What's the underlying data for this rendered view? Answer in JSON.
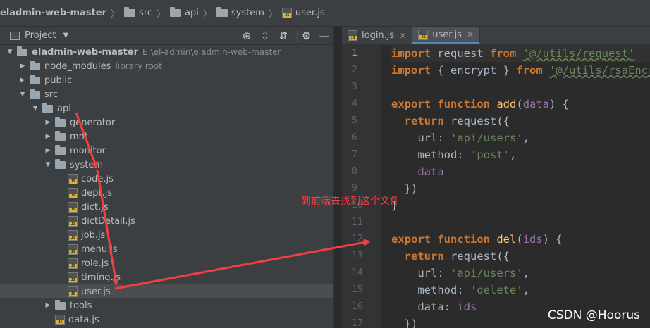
{
  "breadcrumb": [
    "eladmin-web-master",
    "src",
    "api",
    "system",
    "user.js"
  ],
  "project_panel": {
    "title": "Project",
    "tools": [
      "crosshair-icon",
      "expand-all-icon",
      "collapse-all-icon",
      "gear-icon",
      "minimize-icon"
    ]
  },
  "tree": [
    {
      "label": "eladmin-web-master",
      "hint": "E:\\el-admin\\eladmin-web-master",
      "type": "folder",
      "depth": 0,
      "expanded": true
    },
    {
      "label": "node_modules",
      "hint": "library root",
      "type": "folder",
      "depth": 1,
      "expanded": false
    },
    {
      "label": "public",
      "hint": "",
      "type": "folder",
      "depth": 1,
      "expanded": false
    },
    {
      "label": "src",
      "hint": "",
      "type": "folder",
      "depth": 1,
      "expanded": true
    },
    {
      "label": "api",
      "hint": "",
      "type": "folder",
      "depth": 2,
      "expanded": true
    },
    {
      "label": "generator",
      "hint": "",
      "type": "folder",
      "depth": 3,
      "expanded": false
    },
    {
      "label": "mnt",
      "hint": "",
      "type": "folder",
      "depth": 3,
      "expanded": false
    },
    {
      "label": "monitor",
      "hint": "",
      "type": "folder",
      "depth": 3,
      "expanded": false
    },
    {
      "label": "system",
      "hint": "",
      "type": "folder",
      "depth": 3,
      "expanded": true
    },
    {
      "label": "code.js",
      "hint": "",
      "type": "js",
      "depth": 4
    },
    {
      "label": "dept.js",
      "hint": "",
      "type": "js",
      "depth": 4
    },
    {
      "label": "dict.js",
      "hint": "",
      "type": "js",
      "depth": 4
    },
    {
      "label": "dictDetail.js",
      "hint": "",
      "type": "js",
      "depth": 4
    },
    {
      "label": "job.js",
      "hint": "",
      "type": "js",
      "depth": 4
    },
    {
      "label": "menu.js",
      "hint": "",
      "type": "js",
      "depth": 4
    },
    {
      "label": "role.js",
      "hint": "",
      "type": "js",
      "depth": 4
    },
    {
      "label": "timing.js",
      "hint": "",
      "type": "js",
      "depth": 4
    },
    {
      "label": "user.js",
      "hint": "",
      "type": "js",
      "depth": 4,
      "selected": true
    },
    {
      "label": "tools",
      "hint": "",
      "type": "folder",
      "depth": 3,
      "expanded": false
    },
    {
      "label": "data.js",
      "hint": "",
      "type": "js",
      "depth": 3
    }
  ],
  "editor": {
    "tabs": [
      {
        "label": "login.js",
        "active": false
      },
      {
        "label": "user.js",
        "active": true
      }
    ],
    "line_numbers": [
      "1",
      "2",
      "3",
      "4",
      "5",
      "6",
      "7",
      "8",
      "9",
      "10",
      "11",
      "12",
      "13",
      "14",
      "15",
      "16",
      "17"
    ],
    "code": [
      [
        {
          "t": "import",
          "c": "kw"
        },
        {
          "t": " request ",
          "c": ""
        },
        {
          "t": "from",
          "c": "kw"
        },
        {
          "t": " ",
          "c": ""
        },
        {
          "t": "'@/utils/request'",
          "c": "str ul"
        }
      ],
      [
        {
          "t": "import",
          "c": "kw"
        },
        {
          "t": " { encrypt } ",
          "c": ""
        },
        {
          "t": "from",
          "c": "kw"
        },
        {
          "t": " ",
          "c": ""
        },
        {
          "t": "'@/utils/rsaEncrypt'",
          "c": "str ul"
        }
      ],
      [],
      [
        {
          "t": "export",
          "c": "kw"
        },
        {
          "t": " ",
          "c": ""
        },
        {
          "t": "function",
          "c": "kw"
        },
        {
          "t": " ",
          "c": ""
        },
        {
          "t": "add",
          "c": "fn"
        },
        {
          "t": "(",
          "c": ""
        },
        {
          "t": "data",
          "c": "prop"
        },
        {
          "t": ") {",
          "c": ""
        }
      ],
      [
        {
          "t": "  ",
          "c": ""
        },
        {
          "t": "return",
          "c": "kw"
        },
        {
          "t": " request({",
          "c": ""
        }
      ],
      [
        {
          "t": "    url: ",
          "c": ""
        },
        {
          "t": "'api/users'",
          "c": "str"
        },
        {
          "t": ",",
          "c": ""
        }
      ],
      [
        {
          "t": "    method: ",
          "c": ""
        },
        {
          "t": "'post'",
          "c": "str"
        },
        {
          "t": ",",
          "c": ""
        }
      ],
      [
        {
          "t": "    ",
          "c": ""
        },
        {
          "t": "data",
          "c": "prop"
        }
      ],
      [
        {
          "t": "  })",
          "c": ""
        }
      ],
      [
        {
          "t": "}",
          "c": ""
        }
      ],
      [],
      [
        {
          "t": "export",
          "c": "kw"
        },
        {
          "t": " ",
          "c": ""
        },
        {
          "t": "function",
          "c": "kw"
        },
        {
          "t": " ",
          "c": ""
        },
        {
          "t": "del",
          "c": "fn"
        },
        {
          "t": "(",
          "c": ""
        },
        {
          "t": "ids",
          "c": "prop"
        },
        {
          "t": ") {",
          "c": ""
        }
      ],
      [
        {
          "t": "  ",
          "c": ""
        },
        {
          "t": "return",
          "c": "kw"
        },
        {
          "t": " request({",
          "c": ""
        }
      ],
      [
        {
          "t": "    url: ",
          "c": ""
        },
        {
          "t": "'api/users'",
          "c": "str"
        },
        {
          "t": ",",
          "c": ""
        }
      ],
      [
        {
          "t": "    method: ",
          "c": ""
        },
        {
          "t": "'delete'",
          "c": "str"
        },
        {
          "t": ",",
          "c": ""
        }
      ],
      [
        {
          "t": "    data: ",
          "c": ""
        },
        {
          "t": "ids",
          "c": "prop"
        }
      ],
      [
        {
          "t": "  })",
          "c": ""
        }
      ]
    ]
  },
  "annotation": "到前端去找到这个文件",
  "watermark": "CSDN @Hoorus",
  "colors": {
    "annotation": "#ff3b3b",
    "accent": "#4a88c7"
  }
}
